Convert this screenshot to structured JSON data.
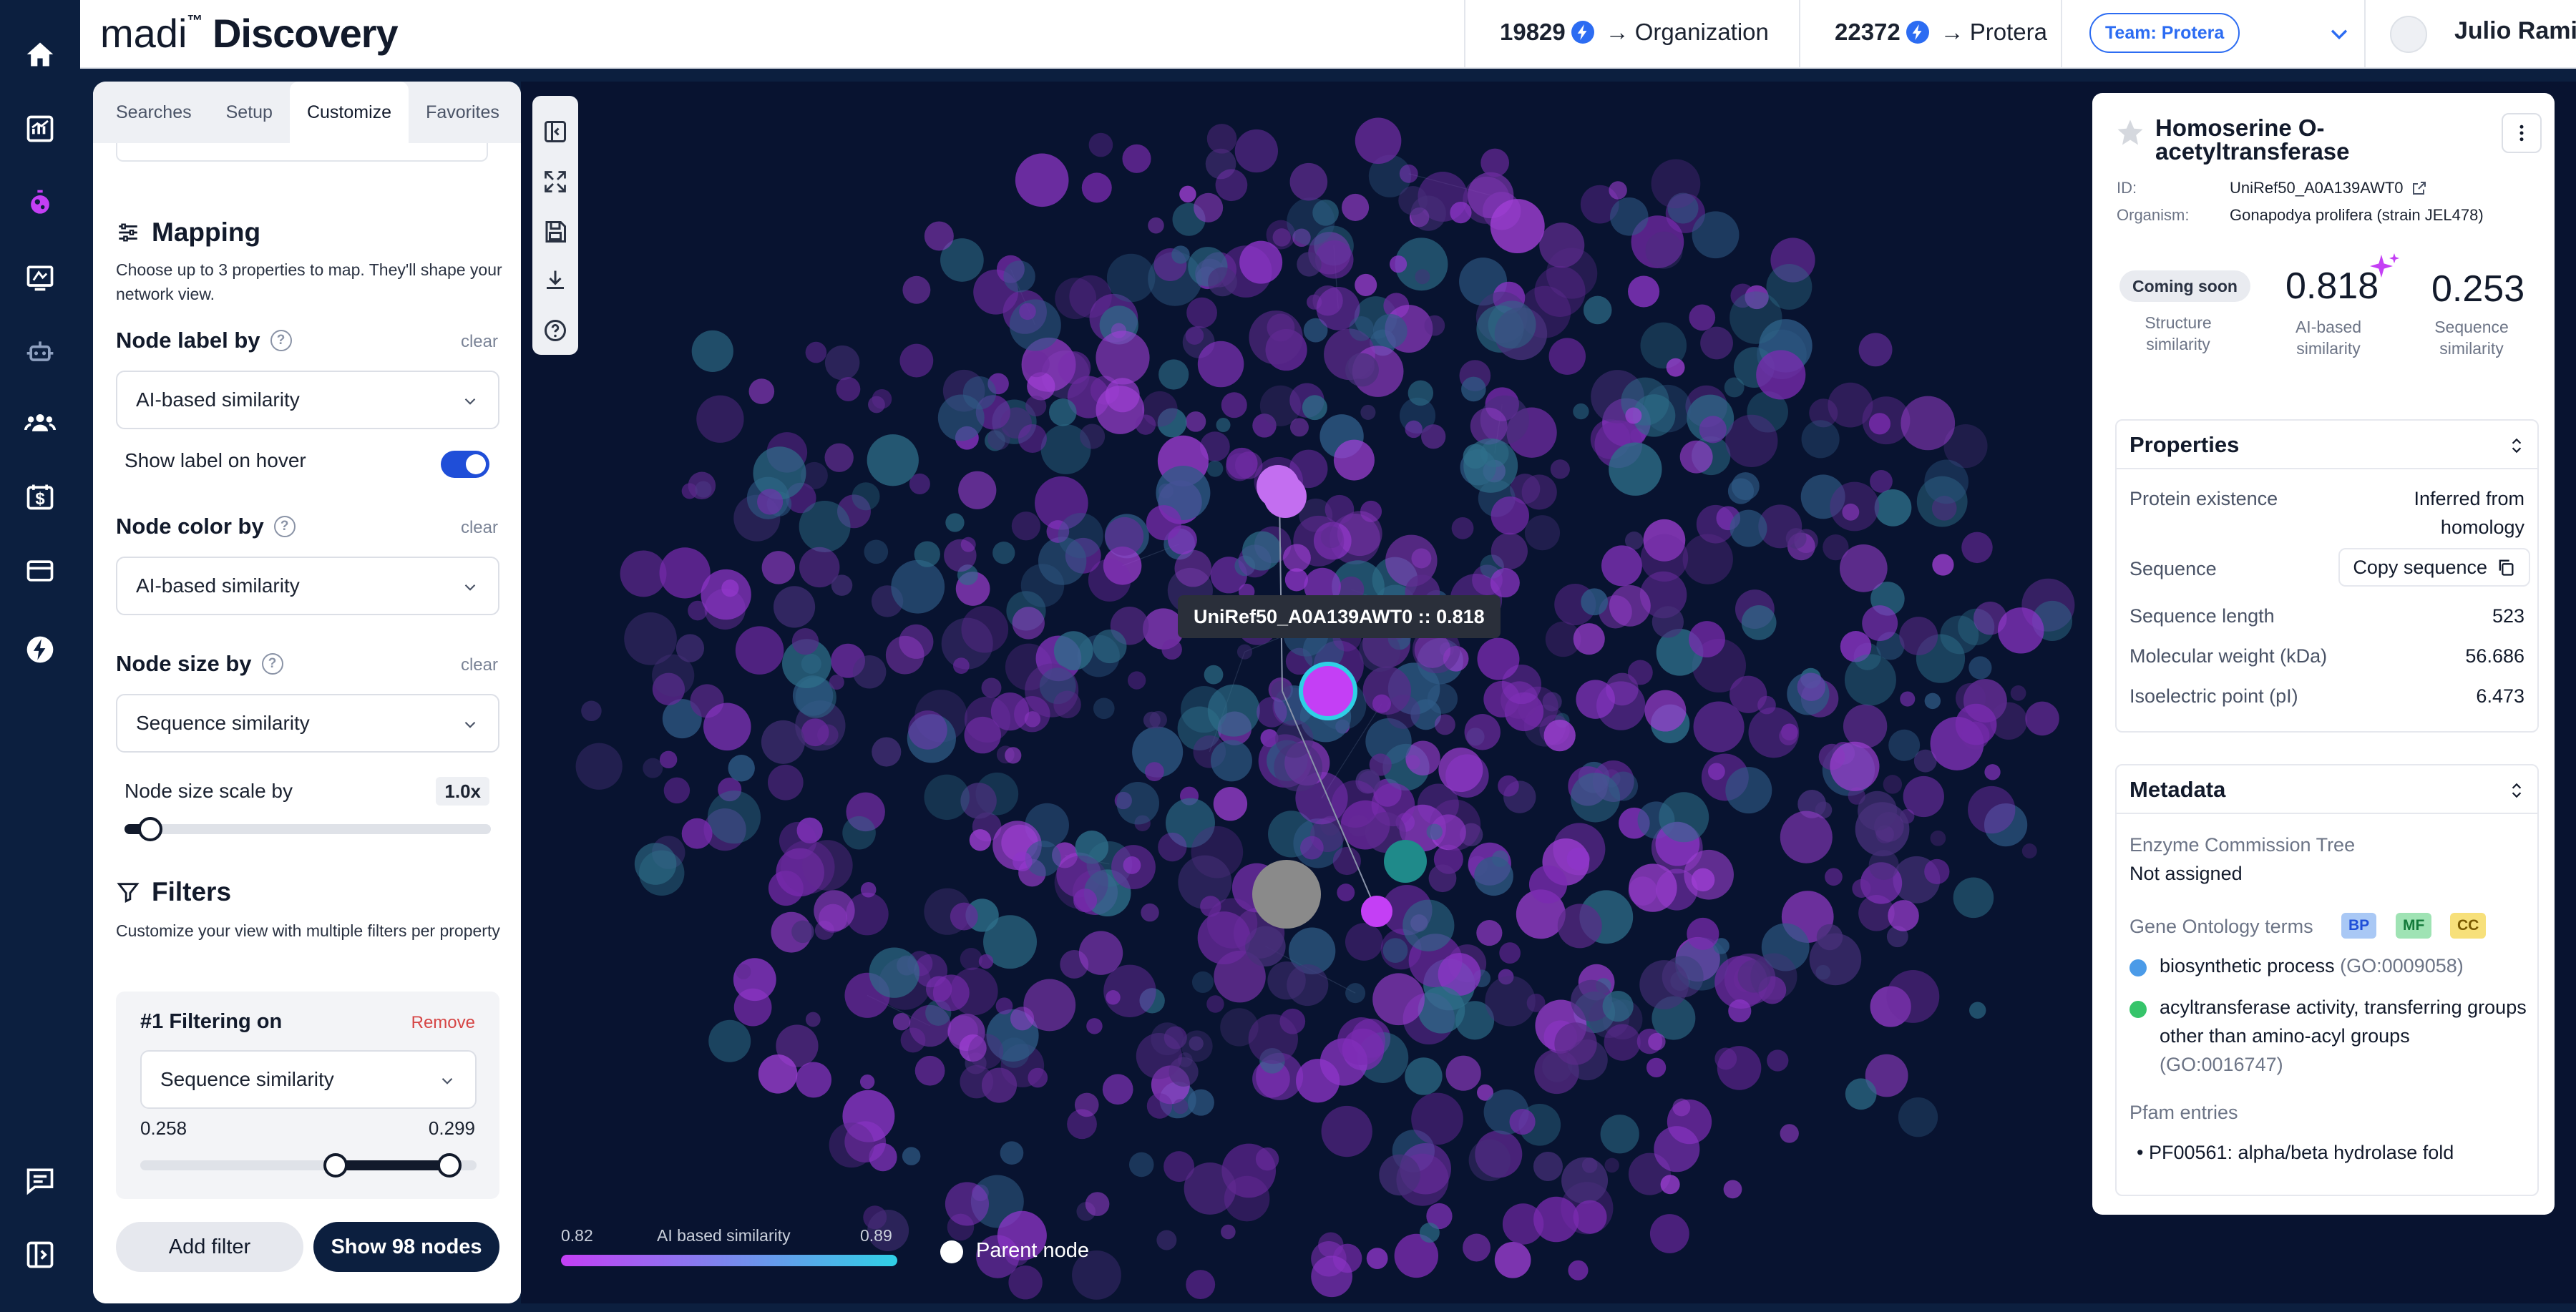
{
  "app": {
    "brand_prefix": "madi",
    "brand_tm": "™",
    "brand_name": "Discovery"
  },
  "credits": [
    {
      "count": "19829",
      "arrow": "→",
      "target": "Organization"
    },
    {
      "count": "22372",
      "arrow": "→",
      "target": "Protera"
    }
  ],
  "team": {
    "label": "Team: Protera"
  },
  "user": {
    "name": "Julio Ramirez"
  },
  "nav_icons": [
    "home-icon",
    "dashboard-icon",
    "discovery-icon",
    "lab-icon",
    "robot-icon",
    "team-icon",
    "billing-icon",
    "card-icon",
    "bolt-icon",
    "chat-icon",
    "collapse-icon"
  ],
  "panel": {
    "tabs": [
      "Searches",
      "Setup",
      "Customize",
      "Favorites"
    ],
    "active_tab": "Customize",
    "mapping": {
      "title": "Mapping",
      "description": "Choose up to 3 properties to map. They'll shape your network view."
    },
    "node_label": {
      "title": "Node label by",
      "clear": "clear",
      "value": "AI-based similarity",
      "hover_label": "Show label on hover",
      "hover_enabled": true
    },
    "node_color": {
      "title": "Node color by",
      "clear": "clear",
      "value": "AI-based similarity"
    },
    "node_size": {
      "title": "Node size by",
      "clear": "clear",
      "value": "Sequence similarity",
      "scale_label": "Node size scale by",
      "scale_value": "1.0x",
      "scale_fraction": 0.07
    },
    "filters": {
      "title": "Filters",
      "description": "Customize your view with multiple filters per property",
      "items": [
        {
          "title": "#1 Filtering on",
          "remove": "Remove",
          "property": "Sequence similarity",
          "min": "0.258",
          "max": "0.299",
          "range_low": 0.58,
          "range_high": 0.92
        }
      ],
      "add_label": "Add filter",
      "show_label": "Show 98 nodes"
    }
  },
  "canvas": {
    "tooltip": "UniRef50_A0A139AWT0 :: 0.818",
    "legend": {
      "min": "0.82",
      "title": "AI based similarity",
      "max": "0.89",
      "color_low": "#c43ff5",
      "color_high": "#2fd0e6"
    },
    "parent_label": "Parent node",
    "tool_icons": [
      "collapse-panel-icon",
      "fit-screen-icon",
      "save-icon",
      "download-icon",
      "help-icon"
    ]
  },
  "detail": {
    "title": "Homoserine O-acetyltransferase",
    "id_label": "ID:",
    "id_value": "UniRef50_A0A139AWT0",
    "organism_label": "Organism:",
    "organism_value": "Gonapodya prolifera (strain JEL478)",
    "structure": {
      "pill": "Coming soon",
      "label": "Structure similarity"
    },
    "ai": {
      "value": "0.818",
      "label": "AI-based similarity"
    },
    "sequence": {
      "value": "0.253",
      "label": "Sequence similarity"
    },
    "properties": {
      "title": "Properties",
      "existence_label": "Protein existence",
      "existence_value_1": "Inferred from",
      "existence_value_2": "homology",
      "sequence_label": "Sequence",
      "copy_label": "Copy sequence",
      "length_label": "Sequence length",
      "length_value": "523",
      "weight_label": "Molecular weight (kDa)",
      "weight_value": "56.686",
      "pi_label": "Isoelectric point (pI)",
      "pi_value": "6.473"
    },
    "metadata": {
      "title": "Metadata",
      "ec_label": "Enzyme Commission Tree",
      "ec_value": "Not assigned",
      "go_label": "Gene Ontology terms",
      "go_badges": [
        {
          "label": "BP",
          "bg": "#a9c8f5",
          "fg": "#1f4ed8"
        },
        {
          "label": "MF",
          "bg": "#9fe3b4",
          "fg": "#137a3a"
        },
        {
          "label": "CC",
          "bg": "#f7e07a",
          "fg": "#7a5a00"
        }
      ],
      "go_terms": [
        {
          "name": "biosynthetic process",
          "id": "(GO:0009058)",
          "color": "#4b9be8"
        },
        {
          "name": "acyltransferase activity, transferring groups other than amino-acyl groups",
          "id": "(GO:0016747)",
          "color": "#36c46a"
        }
      ],
      "pfam_label": "Pfam entries",
      "pfam_items": [
        "PF00561: alpha/beta hydrolase fold"
      ]
    }
  }
}
